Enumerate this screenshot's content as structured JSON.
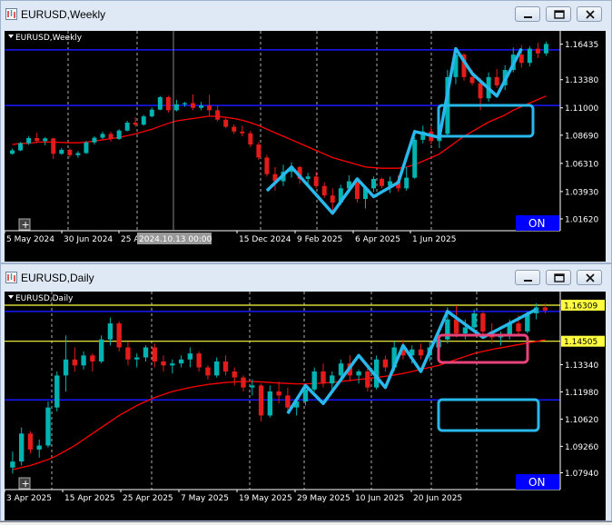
{
  "windows": [
    {
      "title": "EURUSD,Weekly",
      "chart_label": "EURUSD,Weekly",
      "buttons": [
        "minimize",
        "restore",
        "close"
      ]
    },
    {
      "title": "EURUSD,Daily",
      "chart_label": "EURUSD,Daily",
      "buttons": [
        "minimize",
        "restore",
        "close"
      ]
    }
  ],
  "chart_data": [
    {
      "type": "candlestick",
      "title": "EURUSD,Weekly",
      "ylim": [
        1.0062,
        1.1735
      ],
      "y_ticks": [
        1.1638,
        1.1338,
        1.11,
        1.0869,
        1.0631,
        1.0393,
        1.0162
      ],
      "y_tick_labels": [
        "1.16435",
        "1.13380",
        "1.11000",
        "1.08690",
        "1.06310",
        "1.03930",
        "1.01620"
      ],
      "current_price_label": "1.16435",
      "x_tick_labels": [
        "5 May 2024",
        "30 Jun 2024",
        "25 Aug 2024",
        "15 Dec 2024",
        "9 Feb 2025",
        "6 Apr 2025",
        "1 Jun 2025"
      ],
      "crosshair_label": "2024.10.13 00:00",
      "on_badge": "ON",
      "colors": {
        "up": "#00b3b3",
        "down": "#e41b1b",
        "ma": "#ff0000",
        "hline_blue": "#1818ff",
        "overlay_zigzag": "#28b8ec",
        "box": "#28b8ec"
      },
      "moving_average": "red",
      "horizontal_levels": [
        1.159,
        1.112
      ],
      "candles": [
        [
          1.0712,
          1.0756,
          1.0705,
          1.0741
        ],
        [
          1.0741,
          1.0812,
          1.0735,
          1.0801
        ],
        [
          1.0801,
          1.0862,
          1.0788,
          1.0845
        ],
        [
          1.0845,
          1.0889,
          1.0801,
          1.082
        ],
        [
          1.082,
          1.0852,
          1.0783,
          1.0842
        ],
        [
          1.0842,
          1.0848,
          1.0668,
          1.0712
        ],
        [
          1.0712,
          1.0762,
          1.0705,
          1.0745
        ],
        [
          1.0745,
          1.0758,
          1.068,
          1.07
        ],
        [
          1.07,
          1.0735,
          1.0678,
          1.0718
        ],
        [
          1.0718,
          1.082,
          1.071,
          1.0808
        ],
        [
          1.0808,
          1.086,
          1.079,
          1.0848
        ],
        [
          1.0848,
          1.09,
          1.0835,
          1.088
        ],
        [
          1.088,
          1.0898,
          1.0815,
          1.0838
        ],
        [
          1.0838,
          1.092,
          1.083,
          1.0908
        ],
        [
          1.0908,
          1.099,
          1.09,
          1.0975
        ],
        [
          1.0975,
          1.102,
          1.094,
          1.0958
        ],
        [
          1.0958,
          1.104,
          1.095,
          1.1028
        ],
        [
          1.1028,
          1.1102,
          1.102,
          1.1085
        ],
        [
          1.1085,
          1.12,
          1.108,
          1.119
        ],
        [
          1.119,
          1.1201,
          1.106,
          1.108
        ],
        [
          1.108,
          1.1168,
          1.107,
          1.113
        ],
        [
          1.113,
          1.115,
          1.111,
          1.114
        ],
        [
          1.114,
          1.1214,
          1.108,
          1.11
        ],
        [
          1.11,
          1.115,
          1.108,
          1.112
        ],
        [
          1.112,
          1.121,
          1.103,
          1.108
        ],
        [
          1.108,
          1.112,
          1.0985,
          1.1
        ],
        [
          1.1,
          1.1012,
          1.093,
          1.094
        ],
        [
          1.094,
          1.096,
          1.088,
          1.09
        ],
        [
          1.09,
          1.095,
          1.086,
          1.0885
        ],
        [
          1.0885,
          1.0905,
          1.077,
          1.079
        ],
        [
          1.079,
          1.081,
          1.066,
          1.068
        ],
        [
          1.068,
          1.07,
          1.052,
          1.054
        ],
        [
          1.054,
          1.06,
          1.04,
          1.048
        ],
        [
          1.048,
          1.062,
          1.044,
          1.056
        ],
        [
          1.056,
          1.064,
          1.051,
          1.06
        ],
        [
          1.06,
          1.061,
          1.046,
          1.05
        ],
        [
          1.05,
          1.055,
          1.046,
          1.052
        ],
        [
          1.052,
          1.056,
          1.042,
          1.044
        ],
        [
          1.044,
          1.047,
          1.034,
          1.036
        ],
        [
          1.036,
          1.042,
          1.023,
          1.03
        ],
        [
          1.03,
          1.045,
          1.028,
          1.042
        ],
        [
          1.042,
          1.053,
          1.04,
          1.048
        ],
        [
          1.048,
          1.051,
          1.03,
          1.033
        ],
        [
          1.033,
          1.044,
          1.025,
          1.042
        ],
        [
          1.042,
          1.052,
          1.039,
          1.05
        ],
        [
          1.05,
          1.051,
          1.042,
          1.044
        ],
        [
          1.044,
          1.052,
          1.038,
          1.048
        ],
        [
          1.048,
          1.053,
          1.039,
          1.042
        ],
        [
          1.042,
          1.06,
          1.04,
          1.051
        ],
        [
          1.051,
          1.085,
          1.05,
          1.083
        ],
        [
          1.083,
          1.095,
          1.08,
          1.09
        ],
        [
          1.09,
          1.094,
          1.079,
          1.082
        ],
        [
          1.082,
          1.09,
          1.076,
          1.088
        ],
        [
          1.088,
          1.142,
          1.086,
          1.136
        ],
        [
          1.136,
          1.158,
          1.13,
          1.155
        ],
        [
          1.155,
          1.156,
          1.133,
          1.136
        ],
        [
          1.136,
          1.142,
          1.129,
          1.131
        ],
        [
          1.131,
          1.135,
          1.108,
          1.118
        ],
        [
          1.118,
          1.14,
          1.115,
          1.136
        ],
        [
          1.136,
          1.143,
          1.127,
          1.129
        ],
        [
          1.129,
          1.146,
          1.125,
          1.142
        ],
        [
          1.142,
          1.161,
          1.14,
          1.155
        ],
        [
          1.155,
          1.163,
          1.144,
          1.148
        ],
        [
          1.148,
          1.162,
          1.145,
          1.16
        ],
        [
          1.16,
          1.165,
          1.152,
          1.156
        ],
        [
          1.156,
          1.166,
          1.154,
          1.164
        ]
      ],
      "ma_values": [
        1.079,
        1.08,
        1.08,
        1.081,
        1.0812,
        1.081,
        1.0808,
        1.0805,
        1.0805,
        1.081,
        1.082,
        1.083,
        1.084,
        1.085,
        1.0865,
        1.088,
        1.09,
        1.092,
        1.0945,
        1.097,
        1.099,
        1.1,
        1.101,
        1.102,
        1.103,
        1.1028,
        1.102,
        1.101,
        1.0995,
        1.0975,
        1.095,
        1.092,
        1.089,
        1.086,
        1.083,
        1.08,
        1.077,
        1.074,
        1.071,
        1.068,
        1.066,
        1.064,
        1.062,
        1.06,
        1.0595,
        1.059,
        1.059,
        1.059,
        1.06,
        1.062,
        1.065,
        1.068,
        1.071,
        1.076,
        1.081,
        1.086,
        1.09,
        1.094,
        1.098,
        1.101,
        1.104,
        1.108,
        1.111,
        1.114,
        1.117,
        1.12
      ],
      "zigzag": [
        [
          31,
          1.04
        ],
        [
          34,
          1.06
        ],
        [
          39,
          1.021
        ],
        [
          42,
          1.05
        ],
        [
          44,
          1.035
        ],
        [
          47,
          1.047
        ],
        [
          49,
          1.09
        ],
        [
          52,
          1.085
        ],
        [
          54,
          1.16
        ],
        [
          56,
          1.139
        ],
        [
          59,
          1.12
        ],
        [
          62,
          1.16
        ]
      ]
    },
    {
      "type": "candlestick",
      "title": "EURUSD,Daily",
      "ylim": [
        1.071,
        1.169
      ],
      "y_ticks": [
        1.1631,
        1.1451,
        1.1334,
        1.1198,
        1.1062,
        1.0926,
        1.0794
      ],
      "y_tick_labels": [
        "1.16309",
        "1.14505",
        "1.13340",
        "1.11980",
        "1.10620",
        "1.09260",
        "1.07940"
      ],
      "highlighted_y_labels": [
        "1.16309",
        "1.14505"
      ],
      "x_tick_labels": [
        "3 Apr 2025",
        "15 Apr 2025",
        "25 Apr 2025",
        "7 May 2025",
        "19 May 2025",
        "29 May 2025",
        "10 Jun 2025",
        "20 Jun 2025"
      ],
      "on_badge": "ON",
      "colors": {
        "up": "#00b3b3",
        "down": "#e41b1b",
        "ma": "#ff0000",
        "hline_blue": "#1818ff",
        "hline_yellow": "#ffff40",
        "overlay_zigzag": "#28b8ec",
        "box_upper": "#e8437b",
        "box_lower": "#28b8ec"
      },
      "horizontal_levels_blue": [
        1.16,
        1.1158
      ],
      "horizontal_levels_yellow": [
        1.1631,
        1.1451
      ],
      "candles": [
        [
          1.082,
          1.09,
          1.079,
          1.085
        ],
        [
          1.085,
          1.102,
          1.083,
          1.099
        ],
        [
          1.099,
          1.1,
          1.089,
          1.091
        ],
        [
          1.091,
          1.096,
          1.087,
          1.093
        ],
        [
          1.093,
          1.115,
          1.092,
          1.112
        ],
        [
          1.112,
          1.13,
          1.11,
          1.128
        ],
        [
          1.128,
          1.148,
          1.12,
          1.136
        ],
        [
          1.136,
          1.142,
          1.13,
          1.133
        ],
        [
          1.133,
          1.14,
          1.131,
          1.138
        ],
        [
          1.138,
          1.139,
          1.13,
          1.135
        ],
        [
          1.135,
          1.148,
          1.134,
          1.146
        ],
        [
          1.146,
          1.157,
          1.143,
          1.154
        ],
        [
          1.154,
          1.155,
          1.14,
          1.142
        ],
        [
          1.142,
          1.145,
          1.133,
          1.136
        ],
        [
          1.136,
          1.139,
          1.132,
          1.137
        ],
        [
          1.137,
          1.143,
          1.135,
          1.142
        ],
        [
          1.142,
          1.144,
          1.132,
          1.135
        ],
        [
          1.135,
          1.138,
          1.13,
          1.133
        ],
        [
          1.133,
          1.136,
          1.129,
          1.134
        ],
        [
          1.134,
          1.138,
          1.132,
          1.136
        ],
        [
          1.136,
          1.142,
          1.132,
          1.139
        ],
        [
          1.139,
          1.14,
          1.13,
          1.132
        ],
        [
          1.132,
          1.133,
          1.126,
          1.128
        ],
        [
          1.128,
          1.137,
          1.127,
          1.135
        ],
        [
          1.135,
          1.138,
          1.128,
          1.13
        ],
        [
          1.13,
          1.132,
          1.123,
          1.127
        ],
        [
          1.127,
          1.128,
          1.12,
          1.122
        ],
        [
          1.122,
          1.126,
          1.118,
          1.123
        ],
        [
          1.123,
          1.124,
          1.105,
          1.108
        ],
        [
          1.108,
          1.123,
          1.107,
          1.12
        ],
        [
          1.12,
          1.125,
          1.114,
          1.118
        ],
        [
          1.118,
          1.122,
          1.11,
          1.112
        ],
        [
          1.112,
          1.117,
          1.108,
          1.115
        ],
        [
          1.115,
          1.123,
          1.113,
          1.121
        ],
        [
          1.121,
          1.132,
          1.12,
          1.13
        ],
        [
          1.13,
          1.134,
          1.122,
          1.124
        ],
        [
          1.124,
          1.13,
          1.12,
          1.128
        ],
        [
          1.128,
          1.136,
          1.126,
          1.134
        ],
        [
          1.134,
          1.138,
          1.125,
          1.128
        ],
        [
          1.128,
          1.131,
          1.124,
          1.13
        ],
        [
          1.13,
          1.133,
          1.12,
          1.122
        ],
        [
          1.122,
          1.138,
          1.121,
          1.136
        ],
        [
          1.136,
          1.138,
          1.13,
          1.132
        ],
        [
          1.132,
          1.145,
          1.13,
          1.142
        ],
        [
          1.142,
          1.146,
          1.136,
          1.138
        ],
        [
          1.138,
          1.143,
          1.134,
          1.141
        ],
        [
          1.141,
          1.144,
          1.136,
          1.138
        ],
        [
          1.138,
          1.145,
          1.135,
          1.142
        ],
        [
          1.142,
          1.15,
          1.138,
          1.146
        ],
        [
          1.146,
          1.162,
          1.144,
          1.156
        ],
        [
          1.156,
          1.163,
          1.147,
          1.149
        ],
        [
          1.149,
          1.156,
          1.146,
          1.152
        ],
        [
          1.152,
          1.161,
          1.15,
          1.159
        ],
        [
          1.159,
          1.16,
          1.148,
          1.15
        ],
        [
          1.15,
          1.154,
          1.144,
          1.147
        ],
        [
          1.147,
          1.15,
          1.143,
          1.148
        ],
        [
          1.148,
          1.156,
          1.146,
          1.154
        ],
        [
          1.154,
          1.158,
          1.148,
          1.15
        ],
        [
          1.15,
          1.16,
          1.149,
          1.159
        ],
        [
          1.159,
          1.164,
          1.156,
          1.162
        ],
        [
          1.162,
          1.164,
          1.159,
          1.1605
        ]
      ],
      "ma_values": [
        1.081,
        1.082,
        1.083,
        1.0845,
        1.086,
        1.088,
        1.0905,
        1.093,
        1.096,
        1.099,
        1.102,
        1.105,
        1.108,
        1.1105,
        1.113,
        1.115,
        1.117,
        1.1185,
        1.12,
        1.121,
        1.122,
        1.1228,
        1.1235,
        1.124,
        1.1245,
        1.1248,
        1.125,
        1.125,
        1.1248,
        1.1245,
        1.1242,
        1.124,
        1.1238,
        1.1238,
        1.124,
        1.1242,
        1.1246,
        1.125,
        1.1255,
        1.126,
        1.1265,
        1.127,
        1.1276,
        1.1282,
        1.129,
        1.13,
        1.131,
        1.132,
        1.133,
        1.1345,
        1.136,
        1.1375,
        1.139,
        1.14,
        1.141,
        1.1418,
        1.1426,
        1.1434,
        1.1442,
        1.145,
        1.1458
      ],
      "zigzag": [
        [
          31,
          1.109
        ],
        [
          33,
          1.123
        ],
        [
          35,
          1.114
        ],
        [
          39,
          1.138
        ],
        [
          42,
          1.122
        ],
        [
          44,
          1.143
        ],
        [
          46,
          1.13
        ],
        [
          49,
          1.16
        ],
        [
          53,
          1.147
        ],
        [
          59,
          1.161
        ]
      ]
    }
  ]
}
